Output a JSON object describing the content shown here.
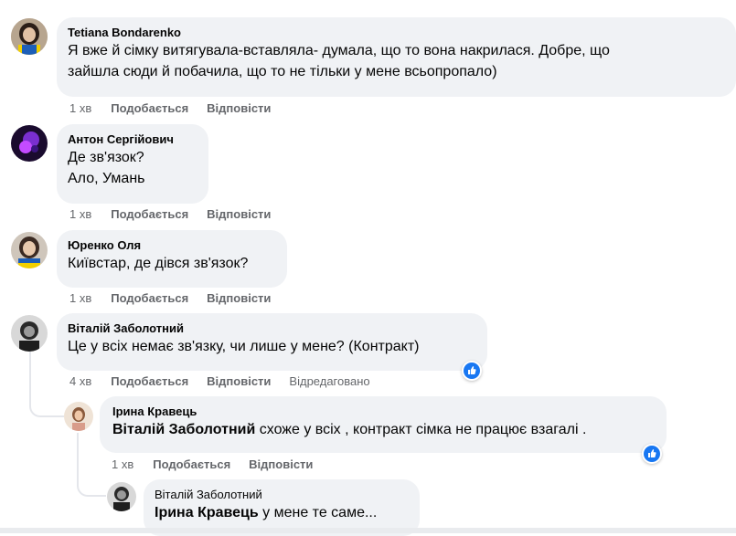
{
  "comments": [
    {
      "author": "Tetiana Bondarenko",
      "lines": [
        "Я вже й сімку витягувала-вставляла- думала, що то вона накрилася. Добре, що",
        "зайшла сюди й побачила, що то не тільки у мене всьопропало)"
      ],
      "time": "1 хв",
      "like": "Подобається",
      "reply": "Відповісти"
    },
    {
      "author": "Антон Сергійович",
      "lines": [
        "Де зв'язок?",
        "Ало, Умань"
      ],
      "time": "1 хв",
      "like": "Подобається",
      "reply": "Відповісти"
    },
    {
      "author": "Юренко Оля",
      "lines": [
        "Київстар, де дівся зв'язок?"
      ],
      "time": "1 хв",
      "like": "Подобається",
      "reply": "Відповісти"
    },
    {
      "author": "Віталій Заболотний",
      "lines": [
        "Це у всіх немає зв'язку, чи лише у мене? (Контракт)"
      ],
      "time": "4 хв",
      "like": "Подобається",
      "reply": "Відповісти",
      "edited": "Відредаговано",
      "reaction": "like"
    },
    {
      "author": "Ірина Кравець",
      "mention": "Віталій Заболотний",
      "text": "схоже у всіх , контракт сімка не працює взагалі .",
      "time": "1 хв",
      "like": "Подобається",
      "reply": "Відповісти",
      "reaction": "like"
    },
    {
      "author": "Віталій Заболотний",
      "mention": "Ірина Кравець",
      "text": "у мене те саме..."
    }
  ],
  "colors": {
    "bubble": "#f0f2f5",
    "meta": "#65676b",
    "like_blue": "#1877f2"
  }
}
